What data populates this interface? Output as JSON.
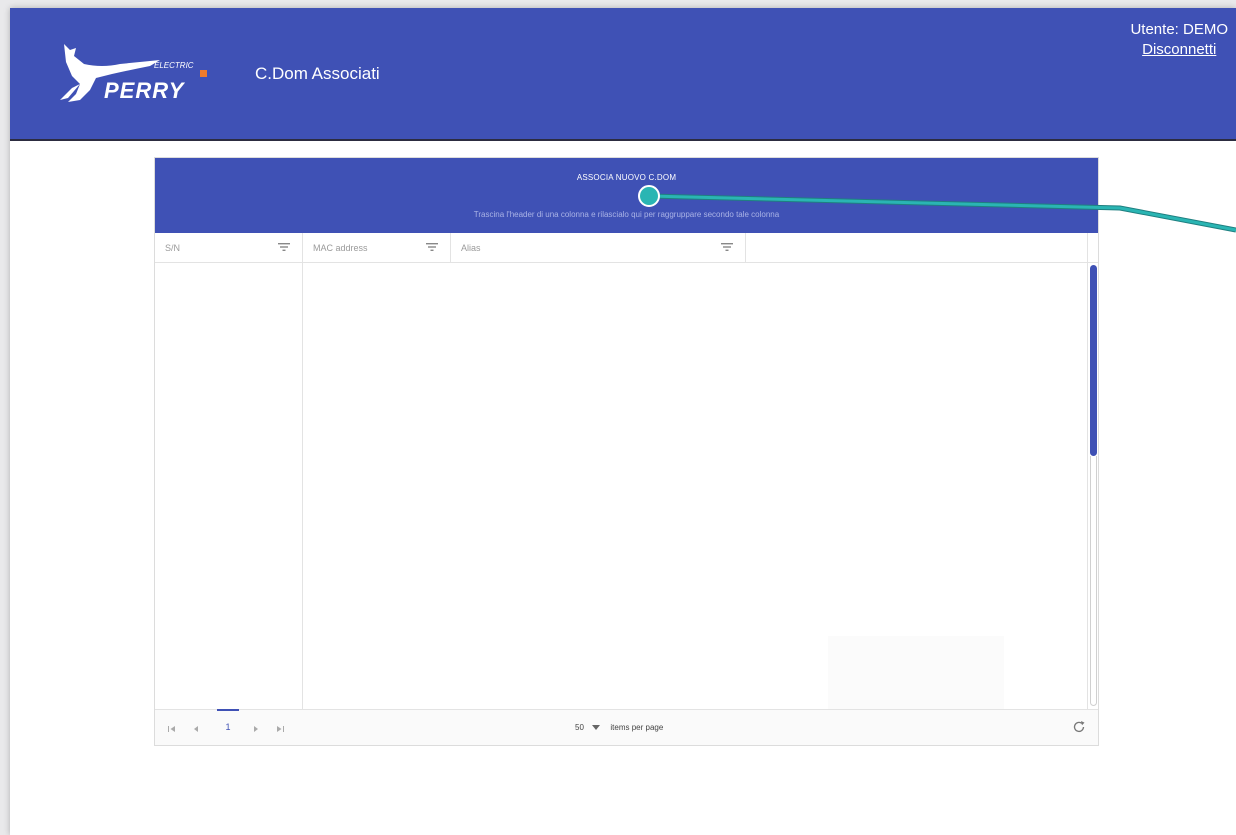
{
  "header": {
    "title": "C.Dom Associati",
    "user_label": "Utente: DEMO",
    "logout_label": "Disconnetti",
    "logo_text": "ELECTRIC PERRY",
    "brand_color": "#3f51b5"
  },
  "grid": {
    "add_button_label": "ASSOCIA NUOVO C.DOM",
    "group_hint": "Trascina l'header di una colonna e rilascialo qui per raggruppare secondo tale colonna",
    "columns": [
      {
        "label": "S/N",
        "icon": "filter-icon"
      },
      {
        "label": "MAC address",
        "icon": "filter-icon"
      },
      {
        "label": "Alias",
        "icon": "filter-icon"
      }
    ],
    "rows": []
  },
  "pager": {
    "current_page": "1",
    "page_size": "50",
    "items_label": "items per page",
    "icons": [
      "first-page-icon",
      "prev-page-icon",
      "next-page-icon",
      "last-page-icon",
      "refresh-icon"
    ]
  },
  "annotation": {
    "callout_color": "#2ab5b3"
  }
}
